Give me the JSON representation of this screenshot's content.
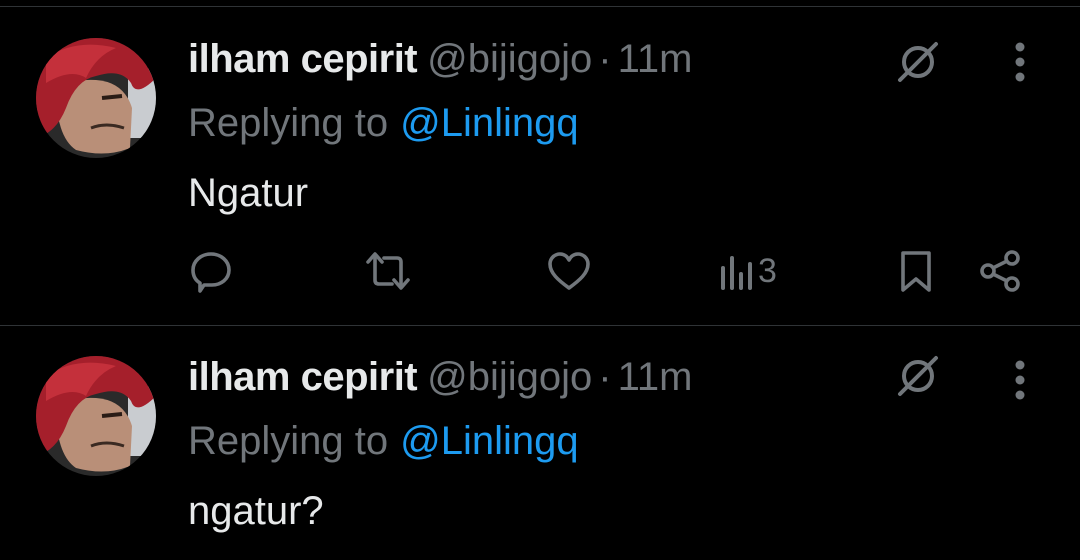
{
  "colors": {
    "background": "#000000",
    "text_primary": "#e7e9ea",
    "text_secondary": "#71767b",
    "link": "#1d9bf0",
    "divider": "#2f3336"
  },
  "tweets": [
    {
      "display_name": "ilham cepirit",
      "handle": "@bijigojo",
      "separator": "·",
      "time": "11m",
      "reply_prefix": "Replying to",
      "reply_mention": "@Linlingq",
      "text": "Ngatur",
      "avatar_icon": "avatar-red-hair",
      "actions": {
        "reply_icon": "reply-icon",
        "retweet_icon": "retweet-icon",
        "like_icon": "like-icon",
        "views_icon": "views-icon",
        "views_count": "3",
        "bookmark_icon": "bookmark-icon",
        "share_icon": "share-icon"
      }
    },
    {
      "display_name": "ilham cepirit",
      "handle": "@bijigojo",
      "separator": "·",
      "time": "11m",
      "reply_prefix": "Replying to",
      "reply_mention": "@Linlingq",
      "text": "ngatur?",
      "avatar_icon": "avatar-red-hair"
    }
  ]
}
